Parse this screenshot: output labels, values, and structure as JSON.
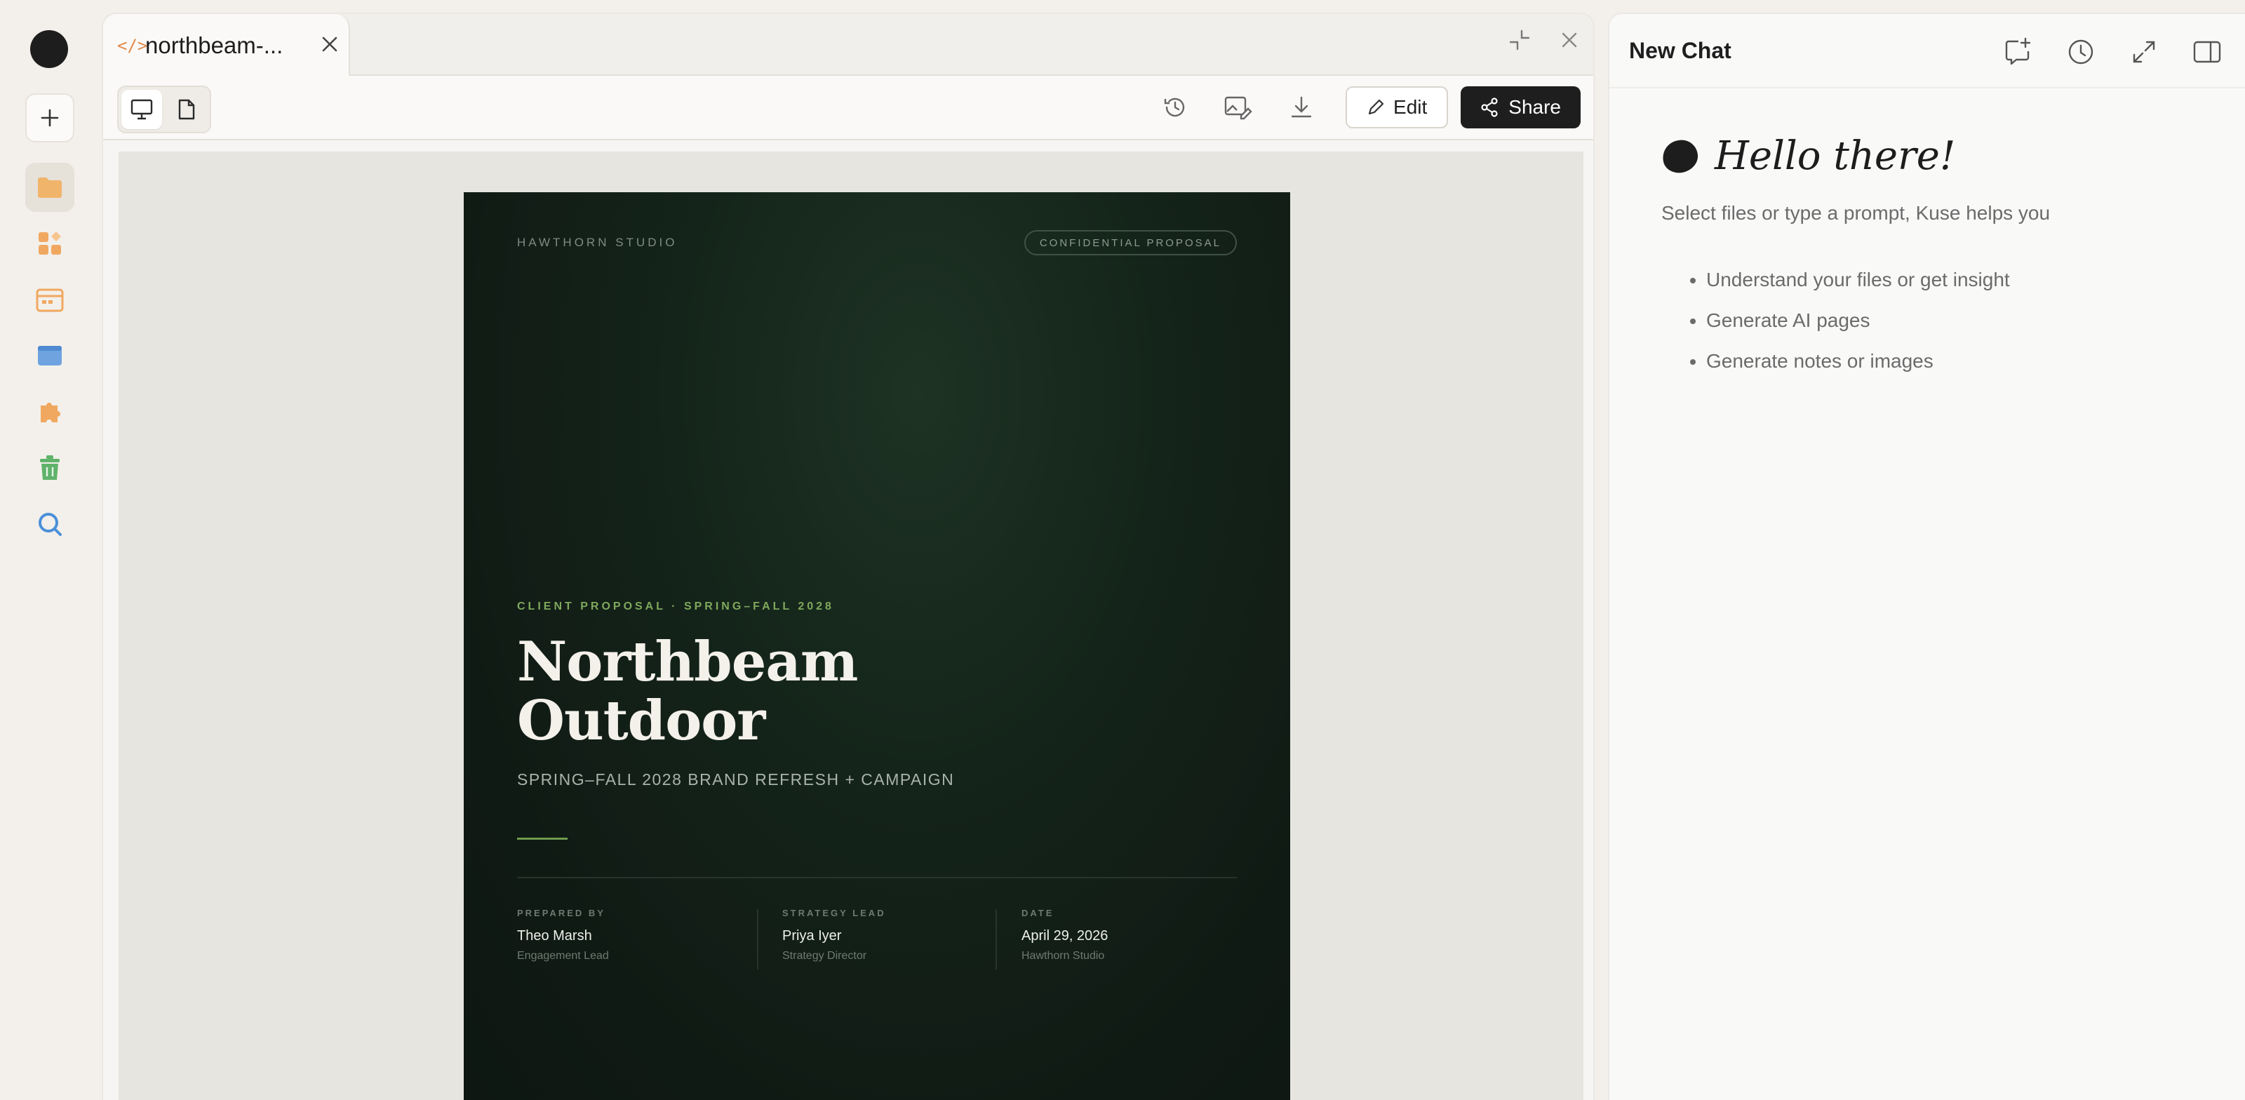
{
  "rail": {
    "items": [
      {
        "name": "new",
        "icon": "plus-icon"
      },
      {
        "name": "files",
        "icon": "folder-icon",
        "color": "#f0b46a"
      },
      {
        "name": "apps",
        "icon": "widgets-icon",
        "color": "#f0a860"
      },
      {
        "name": "calendar",
        "icon": "calendar-icon",
        "color": "#f0a860"
      },
      {
        "name": "window",
        "icon": "window-icon",
        "color": "#6fa3e0"
      },
      {
        "name": "plugins",
        "icon": "puzzle-icon",
        "color": "#f0a860"
      },
      {
        "name": "trash",
        "icon": "trash-icon",
        "color": "#5fb36a"
      },
      {
        "name": "search",
        "icon": "search-icon",
        "color": "#4a90d9"
      }
    ]
  },
  "tab": {
    "title": "northbeam-..."
  },
  "toolbar": {
    "edit_label": "Edit",
    "share_label": "Share"
  },
  "document": {
    "studio": "HAWTHORN STUDIO",
    "confidential": "CONFIDENTIAL PROPOSAL",
    "eyebrow": "CLIENT PROPOSAL · SPRING–FALL 2028",
    "headline_line1": "Northbeam",
    "headline_line2": "Outdoor",
    "subtitle": "SPRING–FALL 2028 BRAND REFRESH + CAMPAIGN",
    "meta": [
      {
        "label": "PREPARED BY",
        "name": "Theo Marsh",
        "role": "Engagement Lead"
      },
      {
        "label": "STRATEGY LEAD",
        "name": "Priya Iyer",
        "role": "Strategy Director"
      },
      {
        "label": "DATE",
        "name": "April 29, 2026",
        "role": "Hawthorn Studio"
      }
    ],
    "accent_color": "#7fa85c"
  },
  "chat": {
    "title": "New Chat",
    "greeting": "Hello there!",
    "intro": "Select files or type a prompt, Kuse helps you",
    "bullets": [
      "Understand your files or get insight",
      "Generate AI pages",
      "Generate notes or images"
    ]
  }
}
